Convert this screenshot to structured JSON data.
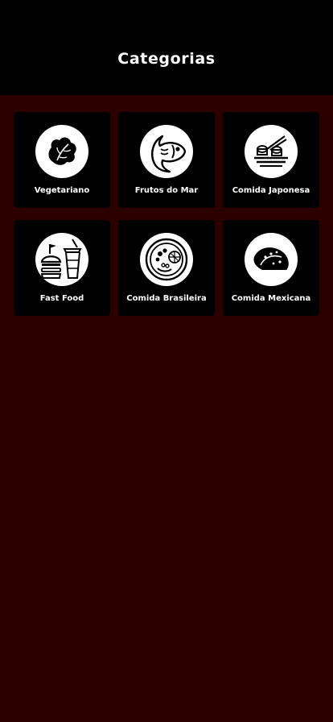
{
  "header": {
    "title": "Categorias"
  },
  "categories": [
    {
      "label": "Vegetariano",
      "icon": "lettuce-icon"
    },
    {
      "label": "Frutos do Mar",
      "icon": "fish-icon"
    },
    {
      "label": "Comida Japonesa",
      "icon": "sushi-icon"
    },
    {
      "label": "Fast Food",
      "icon": "burger-soda-icon"
    },
    {
      "label": "Comida Brasileira",
      "icon": "food-plate-icon"
    },
    {
      "label": "Comida Mexicana",
      "icon": "taco-icon"
    }
  ],
  "colors": {
    "background": "#2d0000",
    "header": "#000000",
    "card": "#000000",
    "icon_circle": "#ffffff",
    "text": "#ffffff"
  }
}
